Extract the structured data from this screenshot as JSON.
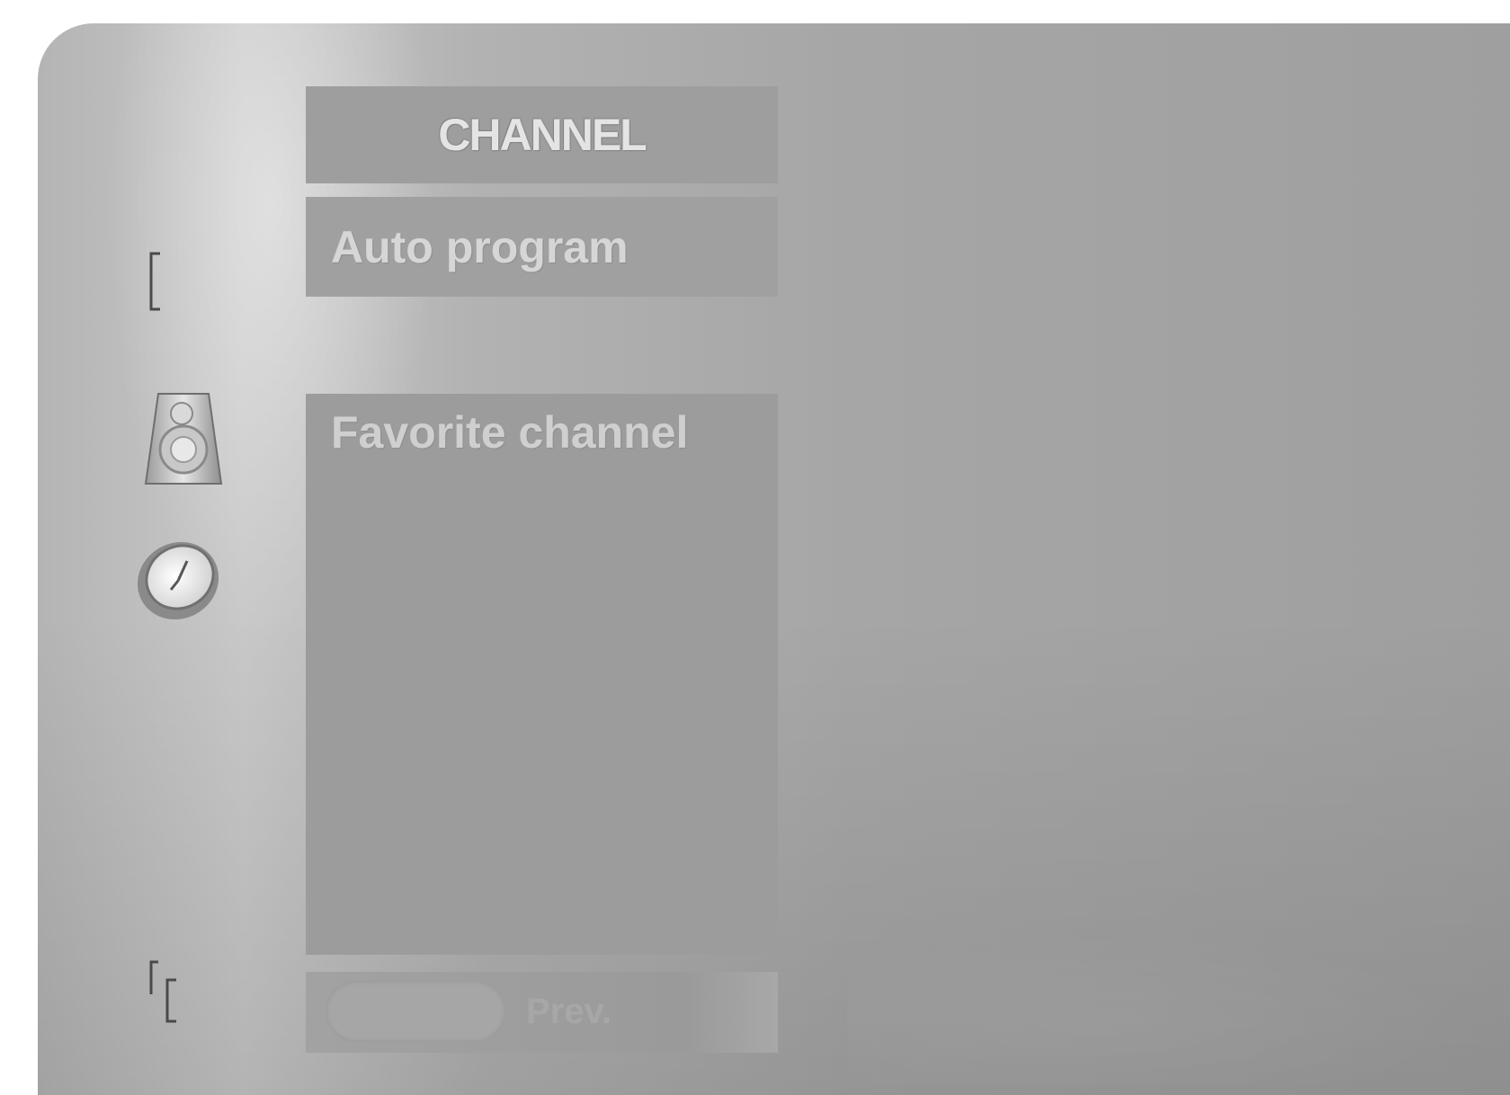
{
  "menu": {
    "title": "CHANNEL",
    "items": [
      {
        "label": "Auto program"
      },
      {
        "label": "Favorite channel"
      }
    ],
    "footer_hint": "Prev."
  },
  "side_icons": [
    {
      "name": "bracket-icon"
    },
    {
      "name": "speaker-icon"
    },
    {
      "name": "clock-icon"
    },
    {
      "name": "input-source-icon"
    }
  ]
}
